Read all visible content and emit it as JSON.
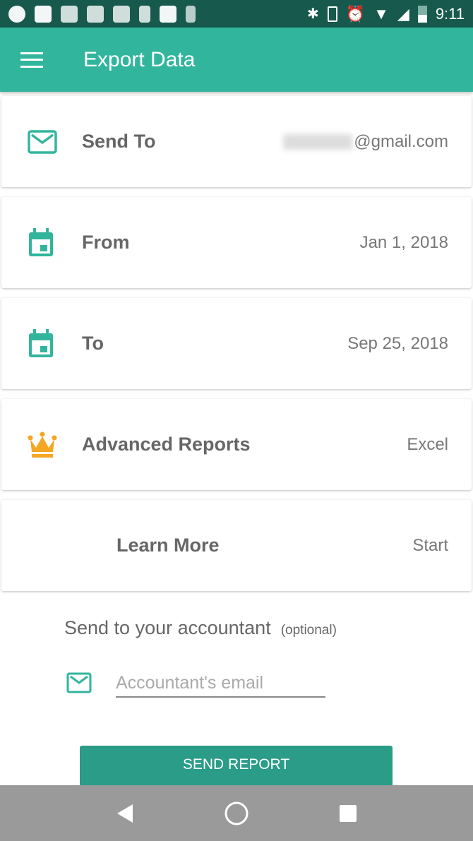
{
  "status_bar": {
    "time": "9:11"
  },
  "app_bar": {
    "title": "Export Data",
    "menu_icon": "hamburger-icon"
  },
  "rows": [
    {
      "label": "Send To",
      "value": "@gmail.com",
      "icon": "email-icon"
    },
    {
      "label": "From",
      "value": "Jan 1, 2018",
      "icon": "calendar-icon"
    },
    {
      "label": "To",
      "value": "Sep 25, 2018",
      "icon": "calendar-icon"
    },
    {
      "label": "Advanced Reports",
      "value": "Excel",
      "icon": "crown-icon"
    },
    {
      "label": "Learn More",
      "value": "Start"
    }
  ],
  "accountant": {
    "heading": "Send to your accountant",
    "optional": "(optional)",
    "placeholder": "Accountant's email"
  },
  "send_button": "SEND REPORT",
  "colors": {
    "accent": "#32b59d",
    "button": "#2a9c88",
    "crown": "#f5a623",
    "status_bar": "#17594d"
  }
}
